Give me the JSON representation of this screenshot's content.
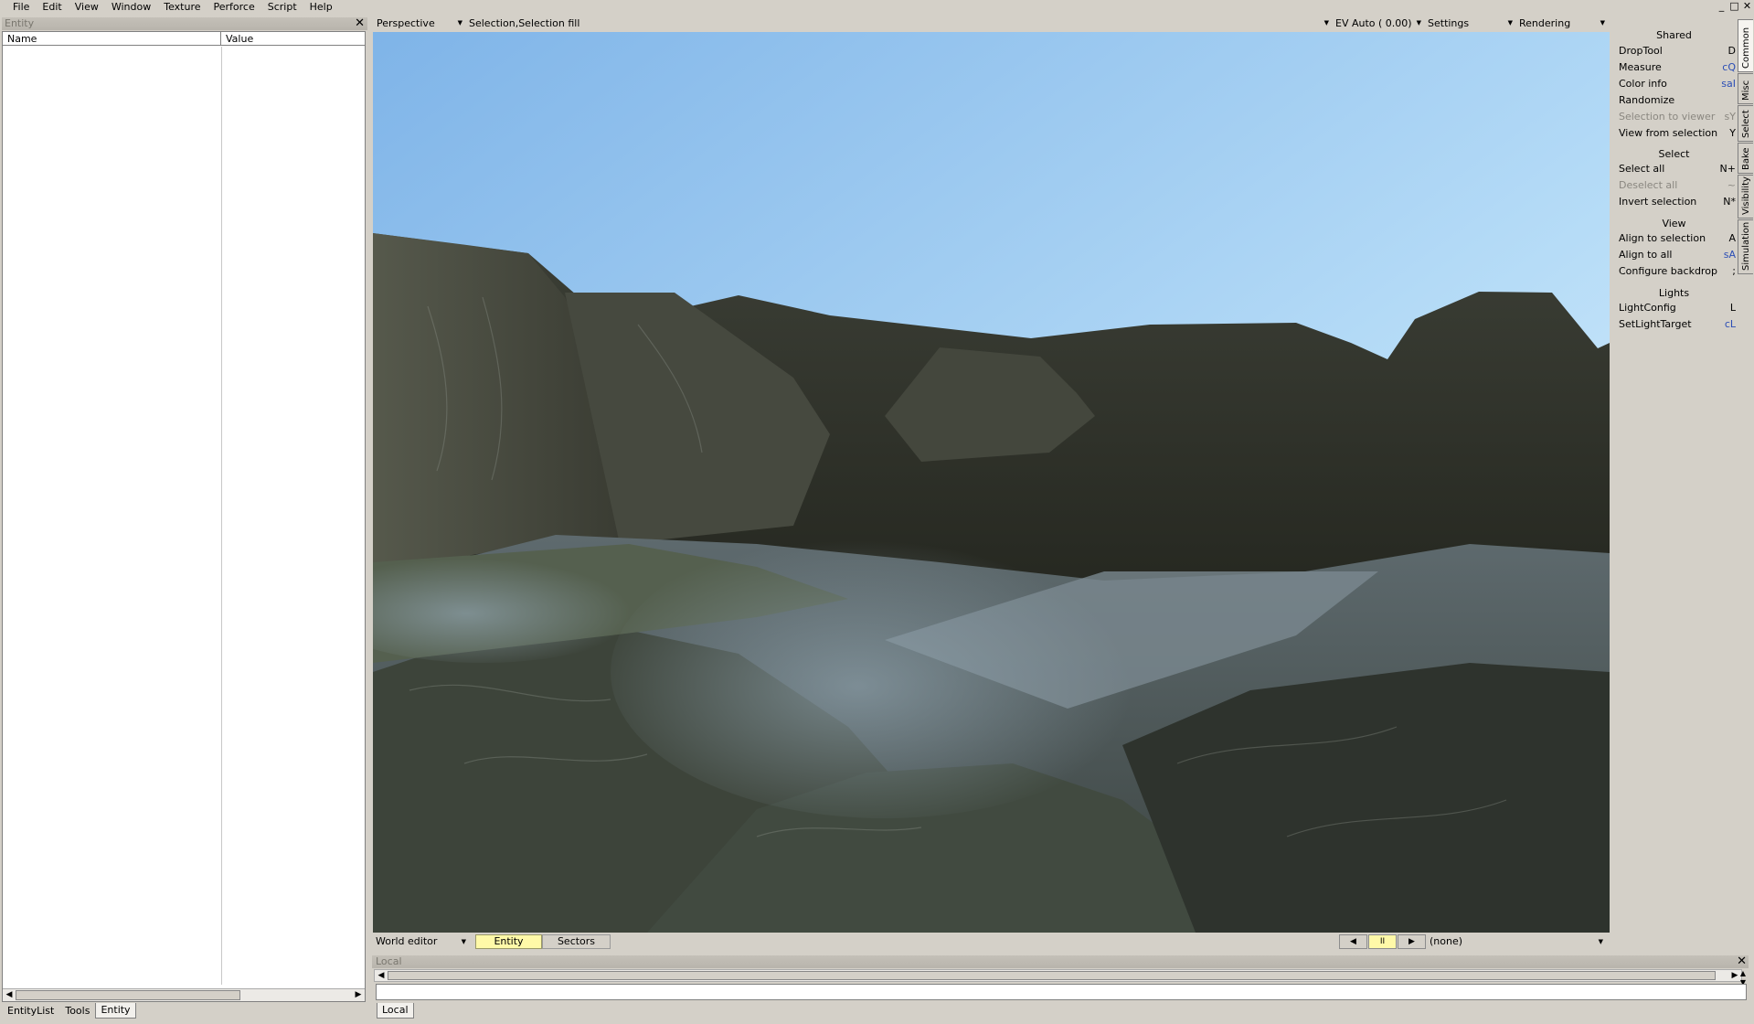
{
  "menubar": {
    "items": [
      "File",
      "Edit",
      "View",
      "Window",
      "Texture",
      "Perforce",
      "Script",
      "Help"
    ],
    "controls": [
      "_",
      "□",
      "✕"
    ]
  },
  "left_panel": {
    "title": "Entity",
    "columns": {
      "name": "Name",
      "value": "Value"
    },
    "tabs": [
      "EntityList",
      "Tools",
      "Entity"
    ],
    "active_tab": "Entity"
  },
  "viewport": {
    "camera_mode": "Perspective",
    "selection_mode": "Selection,Selection fill",
    "exposure": "EV Auto ( 0.00)",
    "settings": "Settings",
    "rendering": "Rendering"
  },
  "viewport_bottom": {
    "editor_mode": "World editor",
    "tab_entity": "Entity",
    "tab_sectors": "Sectors",
    "prev_icon": "◀",
    "pause_icon": "II",
    "next_icon": "▶",
    "animation": "(none)"
  },
  "console": {
    "title": "Local",
    "tab": "Local",
    "input_value": ""
  },
  "right_panel": {
    "sections": [
      {
        "header": "Shared",
        "items": [
          {
            "label": "DropTool",
            "shortcut": "D",
            "style": "normal"
          },
          {
            "label": "Measure",
            "shortcut": "cQ",
            "style": "blue"
          },
          {
            "label": "Color info",
            "shortcut": "saI",
            "style": "blue"
          },
          {
            "label": "Randomize",
            "shortcut": "",
            "style": "normal"
          },
          {
            "label": "Selection to viewer",
            "shortcut": "sY",
            "style": "disabled"
          },
          {
            "label": "View from selection",
            "shortcut": "Y",
            "style": "normal"
          }
        ]
      },
      {
        "header": "Select",
        "items": [
          {
            "label": "Select all",
            "shortcut": "N+",
            "style": "normal"
          },
          {
            "label": "Deselect all",
            "shortcut": "~",
            "style": "disabled"
          },
          {
            "label": "Invert selection",
            "shortcut": "N*",
            "style": "normal"
          }
        ]
      },
      {
        "header": "View",
        "items": [
          {
            "label": "Align to selection",
            "shortcut": "A",
            "style": "normal"
          },
          {
            "label": "Align to all",
            "shortcut": "sA",
            "style": "blue"
          },
          {
            "label": "Configure backdrop",
            "shortcut": ";",
            "style": "normal"
          }
        ]
      },
      {
        "header": "Lights",
        "items": [
          {
            "label": "LightConfig",
            "shortcut": "L",
            "style": "normal"
          },
          {
            "label": "SetLightTarget",
            "shortcut": "cL",
            "style": "blue"
          }
        ]
      }
    ],
    "side_tabs": [
      "Common",
      "Misc",
      "Select",
      "Bake",
      "Visibility",
      "Simulation"
    ],
    "active_side_tab": "Common"
  }
}
